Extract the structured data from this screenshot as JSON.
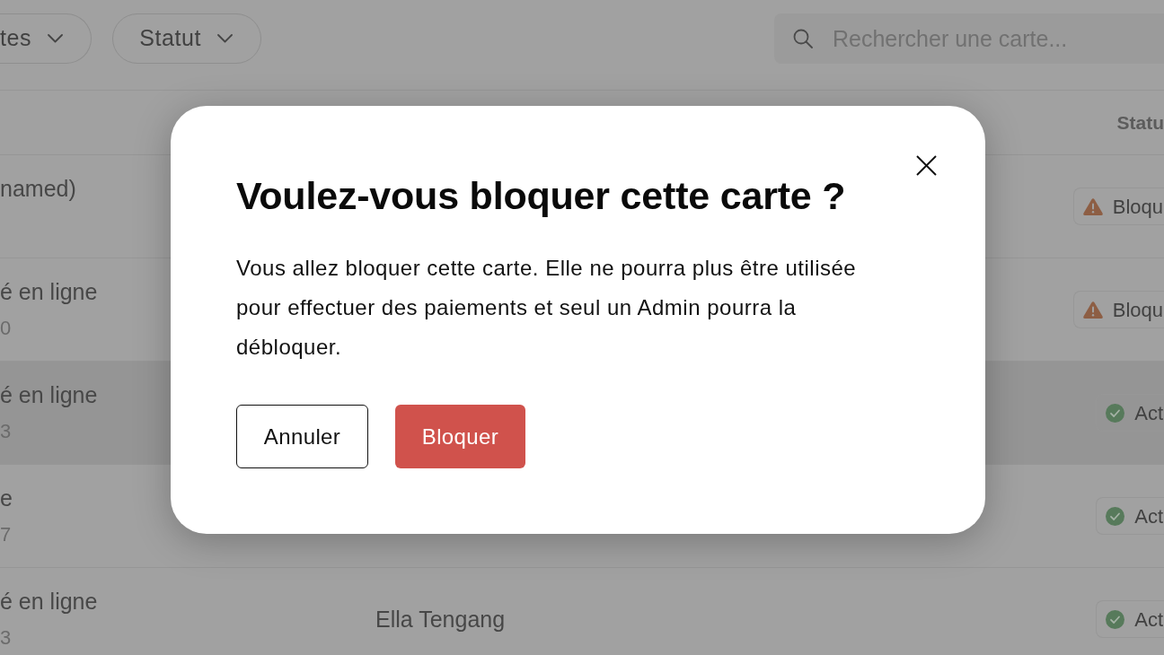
{
  "filters": [
    {
      "label": "tes"
    },
    {
      "label": "Statut"
    }
  ],
  "search": {
    "placeholder": "Rechercher une carte..."
  },
  "table": {
    "status_header": "Statu",
    "rows": [
      {
        "column_1": "named)",
        "highlighted": false,
        "status": {
          "kind": "blocked",
          "label": "Bloqu"
        }
      },
      {
        "column_1": "é en ligne",
        "column_1_detail": "0",
        "highlighted": false,
        "status": {
          "kind": "blocked",
          "label": "Bloqu"
        }
      },
      {
        "column_1": "é en ligne",
        "column_1_detail": "3",
        "highlighted": true,
        "status": {
          "kind": "active",
          "label": "Act"
        }
      },
      {
        "column_1": "e",
        "column_1_detail": "7",
        "highlighted": false,
        "status": {
          "kind": "active",
          "label": "Act"
        }
      },
      {
        "column_1": "é en ligne",
        "column_1_detail": "3",
        "column_2": "Ella Tengang",
        "highlighted": false,
        "status": {
          "kind": "active",
          "label": "Act"
        }
      }
    ]
  },
  "dialog": {
    "title": "Voulez-vous bloquer cette carte ?",
    "message": "Vous allez bloquer cette carte. Elle ne pourra plus être utilisée pour effectuer des paiements et seul un Admin pourra la débloquer.",
    "buttons": [
      {
        "label": "Annuler",
        "kind": "secondary"
      },
      {
        "label": "Bloquer",
        "kind": "danger"
      }
    ]
  }
}
